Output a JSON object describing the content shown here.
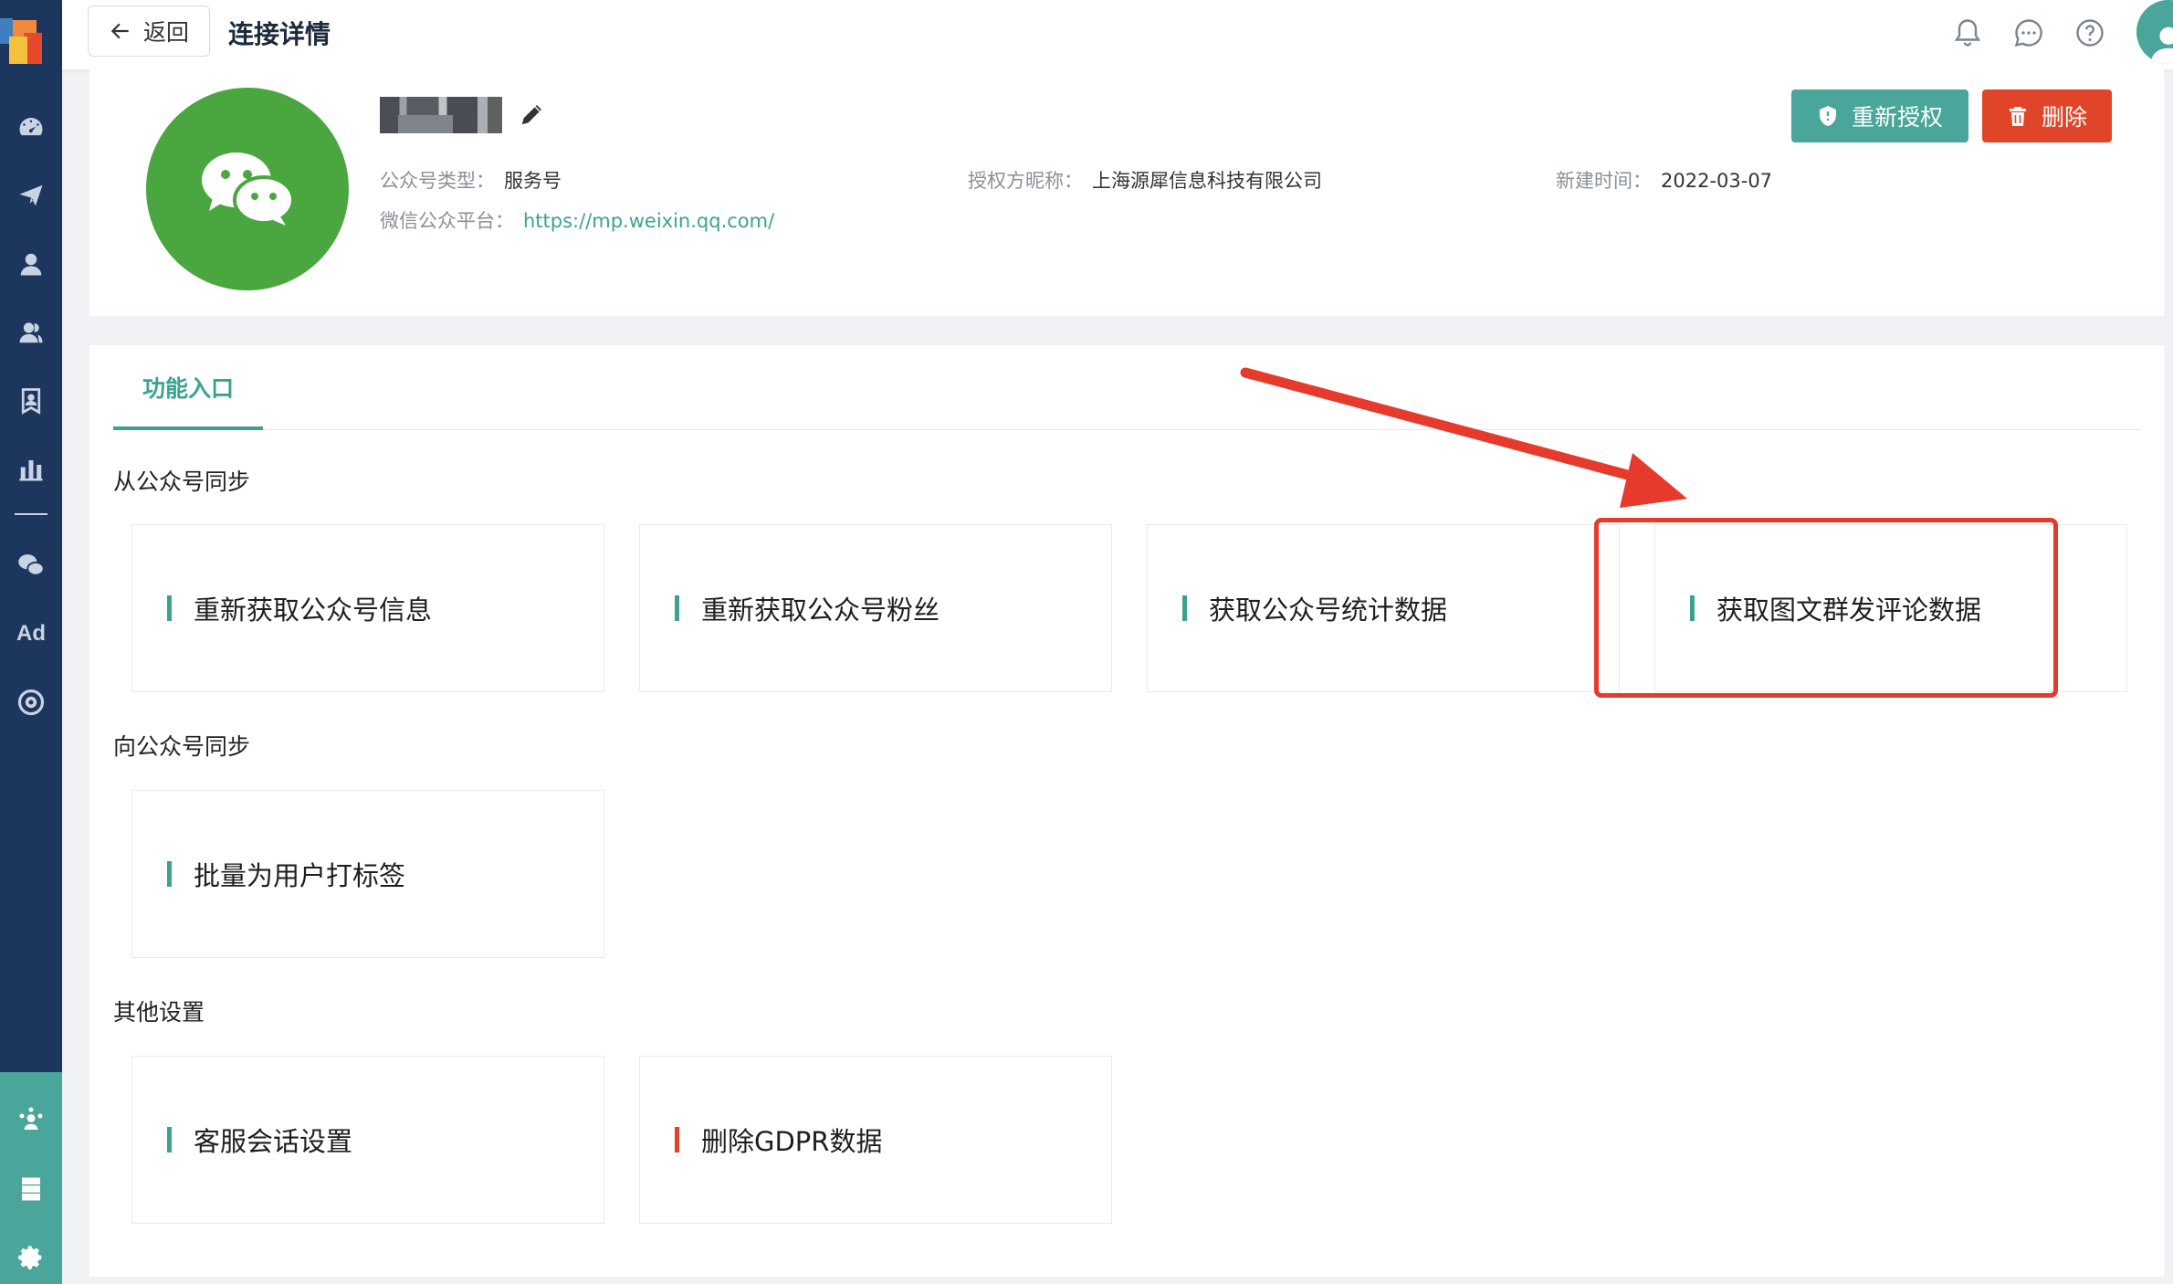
{
  "topbar": {
    "back_label": "返回",
    "title": "连接详情"
  },
  "account": {
    "type_label": "公众号类型：",
    "type_value": "服务号",
    "platform_label": "微信公众平台：",
    "platform_value": "https://mp.weixin.qq.com/",
    "authorizer_label": "授权方昵称：",
    "authorizer_value": "上海源犀信息科技有限公司",
    "created_label": "新建时间：",
    "created_value": "2022-03-07",
    "reauth_label": "重新授权",
    "delete_label": "删除"
  },
  "tabs": [
    {
      "label": "功能入口",
      "active": true
    }
  ],
  "sections": [
    {
      "title": "从公众号同步",
      "items": [
        "重新获取公众号信息",
        "重新获取公众号粉丝",
        "获取公众号统计数据",
        "获取图文群发评论数据"
      ]
    },
    {
      "title": "向公众号同步",
      "items": [
        "批量为用户打标签"
      ]
    },
    {
      "title": "其他设置",
      "items": [
        "客服会话设置",
        "删除GDPR数据"
      ]
    }
  ],
  "sidebar": {
    "ad_label": "Ad"
  },
  "colors": {
    "sidebar": "#1d365e",
    "accent": "#3ca28f",
    "reauth": "#4aa59a",
    "danger": "#e0452a",
    "wechat": "#4aa63e",
    "annotation": "#e53a2c"
  }
}
